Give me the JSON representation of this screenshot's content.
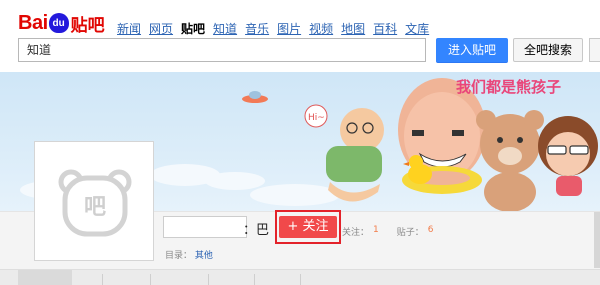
{
  "header": {
    "logo_bai": "Bai",
    "logo_du": "du",
    "logo_tieba": "贴吧",
    "nav": [
      "新闻",
      "网页",
      "贴吧",
      "知道",
      "音乐",
      "图片",
      "视频",
      "地图",
      "百科",
      "文库"
    ],
    "nav_active_index": 2,
    "search_value": "知道",
    "enter_button": "进入贴吧",
    "all_search_button": "全吧搜索"
  },
  "banner": {
    "slogan": "我们都是熊孩子",
    "bubble": "Hi~"
  },
  "forum": {
    "avatar_glyph": "吧",
    "name_suffix": "：巴",
    "follow_button": "+ 关注",
    "follow_label": "关注：",
    "follow_count": "1",
    "posts_label": "贴子：",
    "posts_count": "6",
    "category_label": "目录：",
    "category_value": "其他"
  },
  "colors": {
    "brand_red": "#e10602",
    "brand_blue": "#2319dc",
    "link_blue": "#2d64b3",
    "primary_button": "#3385ff",
    "follow_red": "#f1494a",
    "highlight_border": "#e3222a",
    "count_orange": "#f27c4a"
  }
}
